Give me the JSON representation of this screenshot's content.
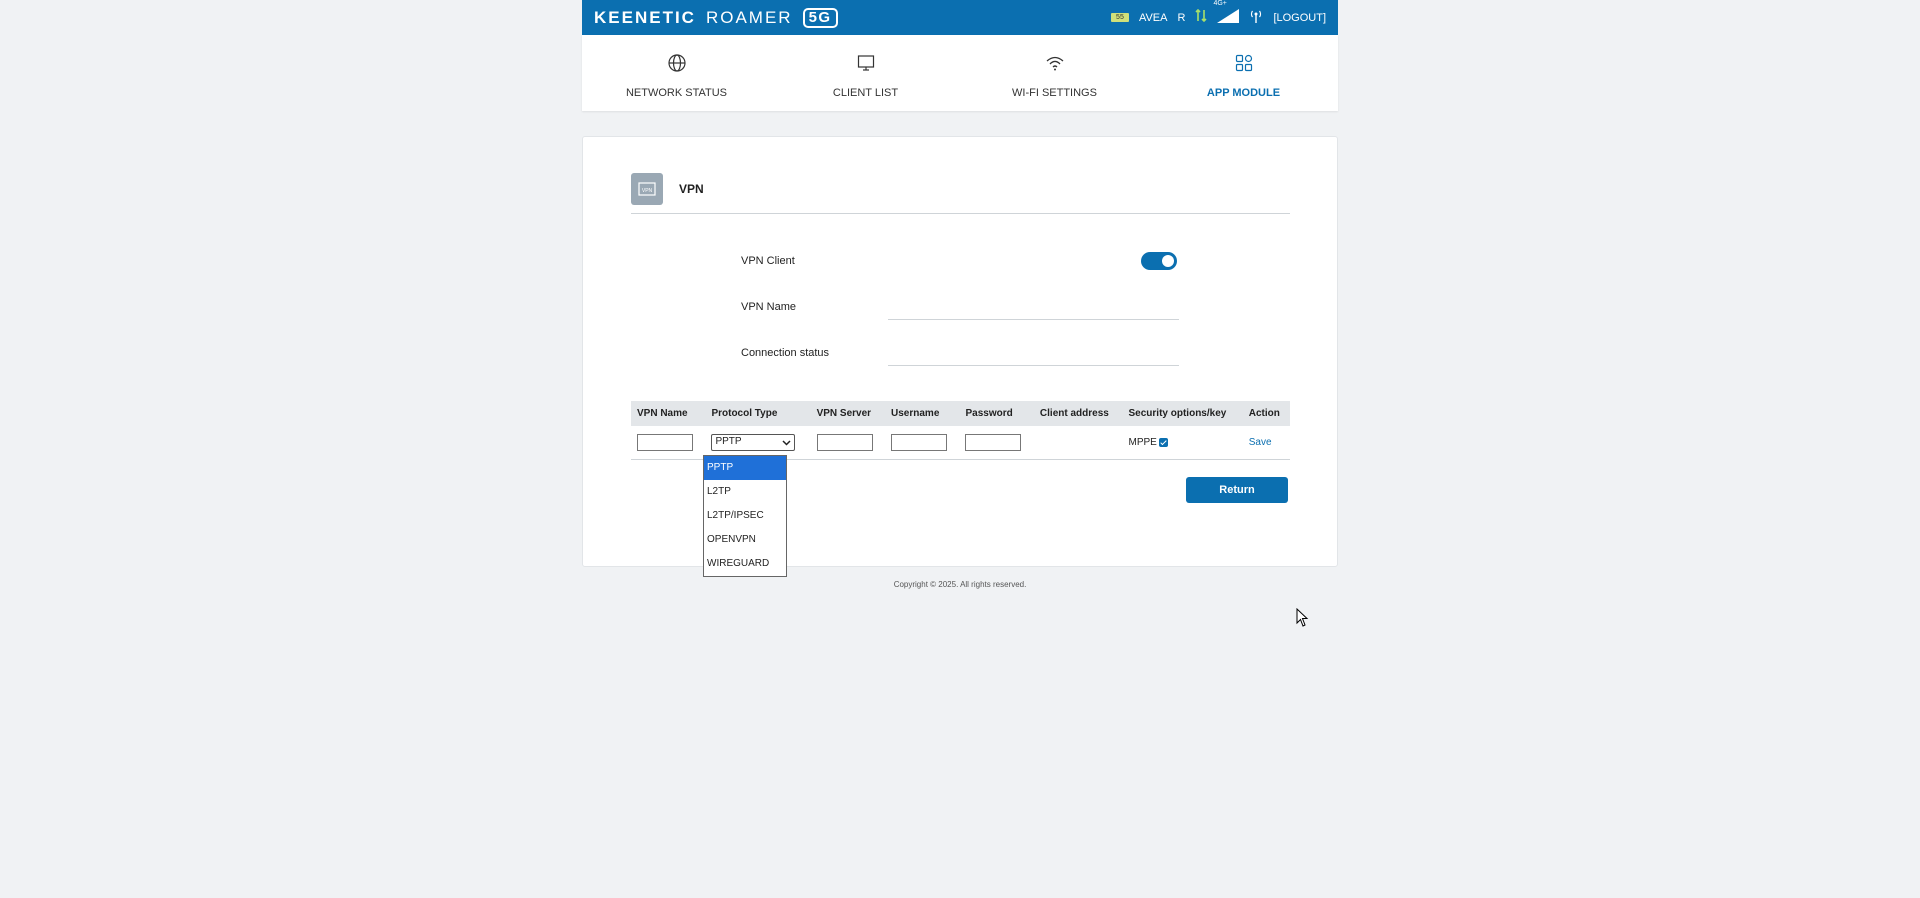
{
  "header": {
    "brand": "KEENETIC",
    "model": "ROAMER",
    "badge": "5G",
    "battery_text": "55",
    "operator": "AVEA",
    "roaming": "R",
    "network_type": "4G+",
    "logout": "[LOGOUT]"
  },
  "nav": {
    "items": [
      {
        "label": "NETWORK STATUS",
        "icon": "globe-icon"
      },
      {
        "label": "CLIENT LIST",
        "icon": "monitor-icon"
      },
      {
        "label": "WI-FI SETTINGS",
        "icon": "wifi-icon"
      },
      {
        "label": "APP MODULE",
        "icon": "apps-icon",
        "active": true
      }
    ]
  },
  "card": {
    "title": "VPN",
    "fields": {
      "vpn_client_label": "VPN Client",
      "vpn_client_enabled": true,
      "vpn_name_label": "VPN Name",
      "connection_status_label": "Connection status"
    },
    "table": {
      "headers": [
        "VPN Name",
        "Protocol Type",
        "VPN Server",
        "Username",
        "Password",
        "Client address",
        "Security options/key",
        "Action"
      ],
      "row": {
        "protocol_selected": "PPTP",
        "security_option": "MPPE",
        "action": "Save"
      }
    },
    "protocol_options": [
      "PPTP",
      "L2TP",
      "L2TP/IPSEC",
      "OPENVPN",
      "WIREGUARD"
    ],
    "return_button": "Return"
  },
  "footer": {
    "copyright": "Copyright © 2025. All rights reserved."
  },
  "colors": {
    "accent": "#0b6fb0",
    "background": "#f0f2f4"
  }
}
